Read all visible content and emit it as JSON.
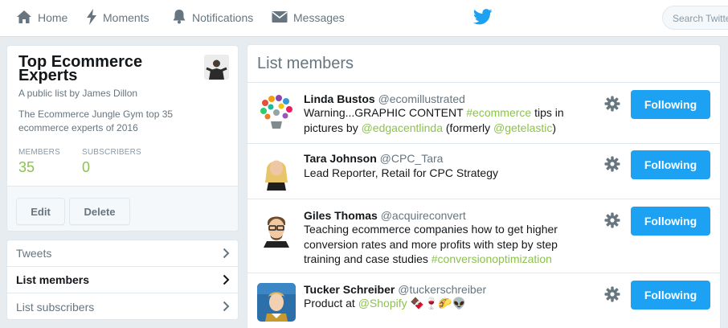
{
  "nav": {
    "home": "Home",
    "moments": "Moments",
    "notifications": "Notifications",
    "messages": "Messages",
    "search_placeholder": "Search Twitter"
  },
  "list": {
    "title": "Top Ecommerce Experts",
    "owner": "A public list by James Dillon",
    "description": "The Ecommerce Jungle Gym top 35 ecommerce experts of 2016",
    "members_label": "MEMBERS",
    "members_count": "35",
    "subscribers_label": "SUBSCRIBERS",
    "subscribers_count": "0",
    "edit_label": "Edit",
    "delete_label": "Delete"
  },
  "sidenav": {
    "items": [
      {
        "label": "Tweets"
      },
      {
        "label": "List members"
      },
      {
        "label": "List subscribers"
      }
    ]
  },
  "main": {
    "title": "List members",
    "follow_label": "Following",
    "members": [
      {
        "name": "Linda Bustos",
        "handle": "@ecomillustrated",
        "bio": {
          "t1": "Warning...GRAPHIC CONTENT ",
          "h1": "#ecommerce",
          "t2": " tips in pictures by ",
          "m1": "@edgacentlinda",
          "t3": " (formerly ",
          "m2": "@getelastic",
          "t4": ")"
        }
      },
      {
        "name": "Tara Johnson",
        "handle": "@CPC_Tara",
        "bio": {
          "t1": "Lead Reporter, Retail for CPC Strategy"
        }
      },
      {
        "name": "Giles Thomas",
        "handle": "@acquireconvert",
        "bio": {
          "t1": "Teaching ecommerce companies how to get higher conversion rates and more profits with step by step training and case studies ",
          "h1": "#conversionoptimization"
        }
      },
      {
        "name": "Tucker Schreiber",
        "handle": "@tuckerschreiber",
        "bio": {
          "t1": "Product at ",
          "m1": "@Shopify",
          "emoji": "🍫🍷🌮👽"
        }
      }
    ]
  },
  "colors": {
    "accent_blue": "#1da1f2",
    "link_green": "#8bc34a"
  },
  "icons": [
    "home-icon",
    "lightning-icon",
    "bell-icon",
    "envelope-icon",
    "twitter-bird-icon",
    "gear-icon",
    "chevron-right-icon"
  ]
}
